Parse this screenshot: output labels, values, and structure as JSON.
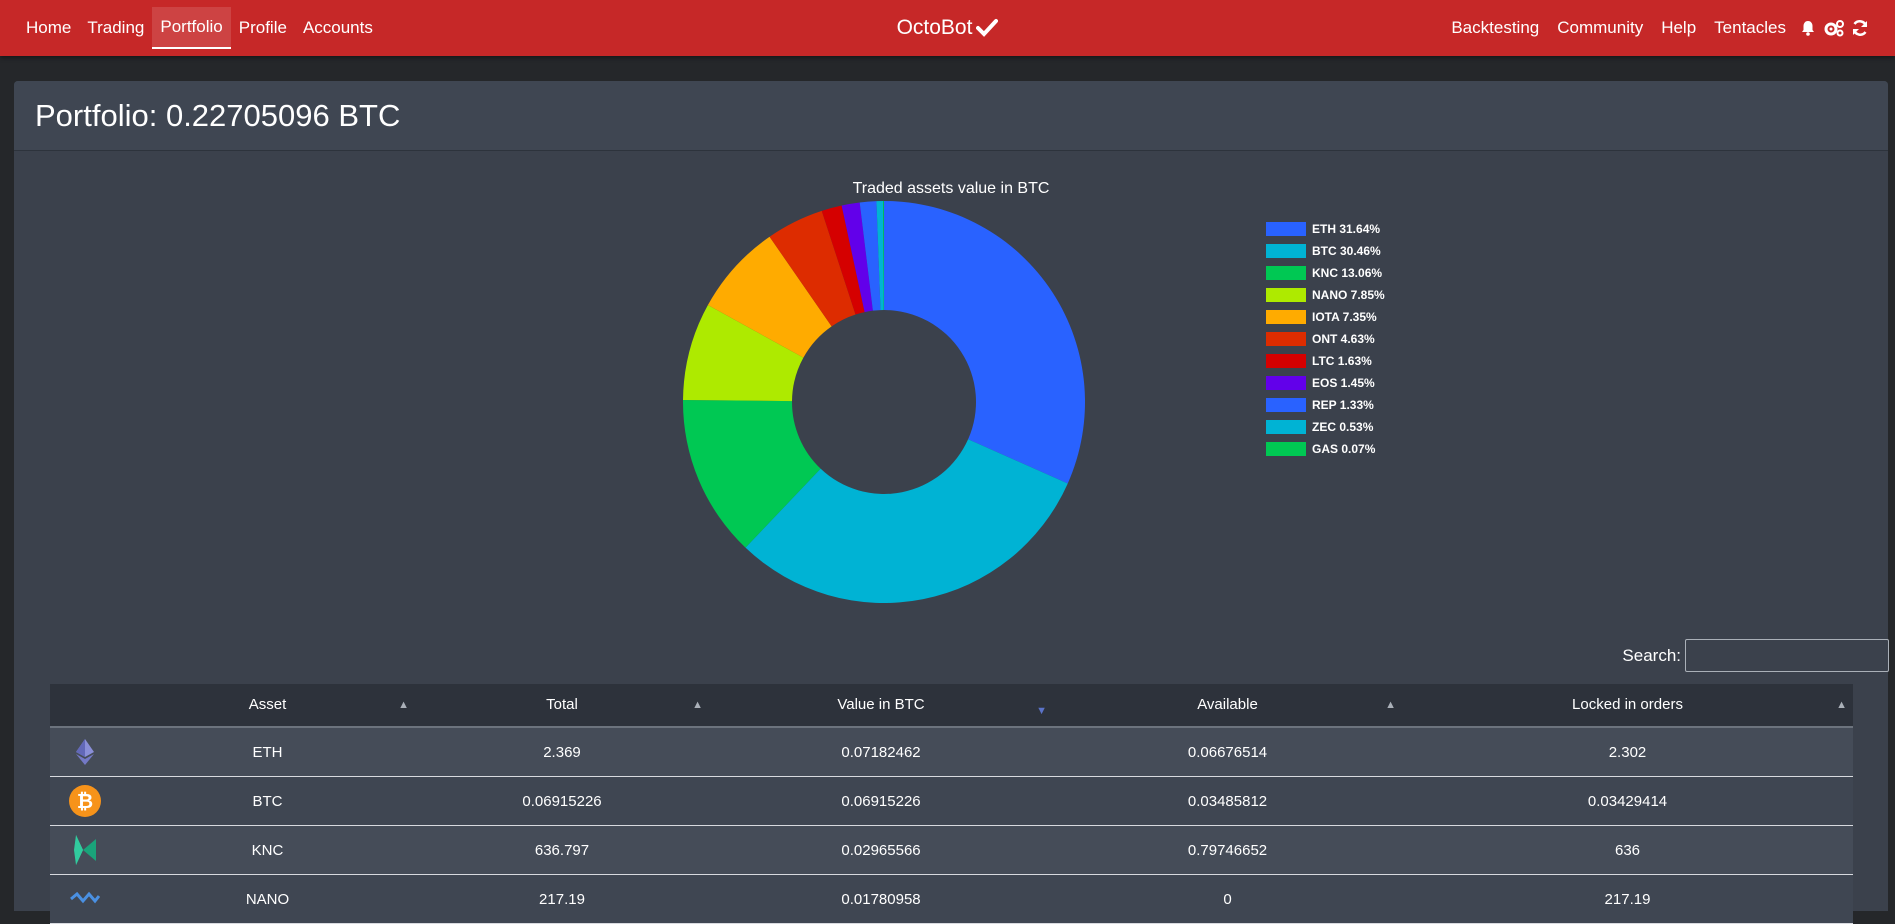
{
  "nav": {
    "left": [
      "Home",
      "Trading",
      "Portfolio",
      "Profile",
      "Accounts"
    ],
    "active": "Portfolio",
    "brand": "OctoBot",
    "right": [
      "Backtesting",
      "Community",
      "Help",
      "Tentacles"
    ],
    "icons": [
      "bell-icon",
      "cogs-icon",
      "refresh-icon"
    ]
  },
  "portfolio": {
    "title": "Portfolio: 0.22705096 BTC"
  },
  "chart_data": {
    "type": "pie",
    "title": "Traded assets value in BTC",
    "donut": true,
    "legend_position": "right",
    "categories": [
      "ETH",
      "BTC",
      "KNC",
      "NANO",
      "IOTA",
      "ONT",
      "LTC",
      "EOS",
      "REP",
      "ZEC",
      "GAS"
    ],
    "values": [
      31.64,
      30.46,
      13.06,
      7.85,
      7.35,
      4.63,
      1.63,
      1.45,
      1.33,
      0.53,
      0.07
    ],
    "labels": [
      "ETH 31.64%",
      "BTC 30.46%",
      "KNC 13.06%",
      "NANO 7.85%",
      "IOTA 7.35%",
      "ONT 4.63%",
      "LTC 1.63%",
      "EOS 1.45%",
      "REP 1.33%",
      "ZEC 0.53%",
      "GAS 0.07%"
    ],
    "colors": [
      "#2962ff",
      "#00b3d4",
      "#00c853",
      "#aeea00",
      "#ffab00",
      "#dd2c00",
      "#d50000",
      "#6200ea",
      "#2962ff",
      "#00b3d4",
      "#00c853"
    ]
  },
  "table": {
    "search_label": "Search:",
    "search_value": "",
    "headers": [
      "Asset",
      "Total",
      "Value in BTC",
      "Available",
      "Locked in orders"
    ],
    "rows": [
      {
        "icon": "eth-icon",
        "asset": "ETH",
        "total": "2.369",
        "value": "0.07182462",
        "available": "0.06676514",
        "locked": "2.302"
      },
      {
        "icon": "btc-icon",
        "asset": "BTC",
        "total": "0.06915226",
        "value": "0.06915226",
        "available": "0.03485812",
        "locked": "0.03429414"
      },
      {
        "icon": "knc-icon",
        "asset": "KNC",
        "total": "636.797",
        "value": "0.02965566",
        "available": "0.79746652",
        "locked": "636"
      },
      {
        "icon": "nano-icon",
        "asset": "NANO",
        "total": "217.19",
        "value": "0.01780958",
        "available": "0",
        "locked": "217.19"
      }
    ]
  }
}
